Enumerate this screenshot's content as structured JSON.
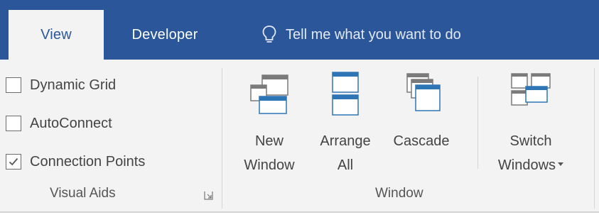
{
  "tabs": {
    "view": "View",
    "developer": "Developer"
  },
  "tellme": {
    "text": "Tell me what you want to do",
    "icon": "lightbulb-icon"
  },
  "visual_aids": {
    "group_label": "Visual Aids",
    "checkboxes": [
      {
        "label": "Dynamic Grid",
        "checked": false
      },
      {
        "label": "AutoConnect",
        "checked": false
      },
      {
        "label": "Connection Points",
        "checked": true
      }
    ]
  },
  "window_group": {
    "group_label": "Window",
    "buttons": {
      "new_window": {
        "line1": "New",
        "line2": "Window",
        "icon": "new-window-icon"
      },
      "arrange_all": {
        "line1": "Arrange",
        "line2": "All",
        "icon": "arrange-all-icon"
      },
      "cascade": {
        "line1": "Cascade",
        "icon": "cascade-icon"
      },
      "switch_windows": {
        "line1": "Switch",
        "line2": "Windows",
        "icon": "switch-windows-icon"
      }
    }
  },
  "colors": {
    "accent": "#2b579a",
    "ribbon": "#f3f3f3",
    "icon_blue": "#2e75b6"
  }
}
